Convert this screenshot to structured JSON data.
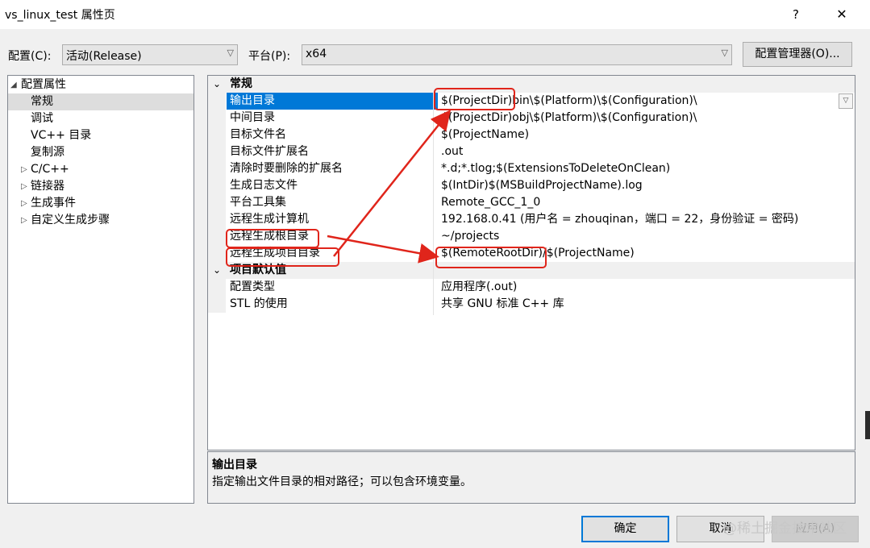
{
  "window": {
    "title": "vs_linux_test 属性页",
    "help_glyph": "?",
    "close_glyph": "✕"
  },
  "config": {
    "label": "配置(C):",
    "value": "活动(Release)",
    "platform_label": "平台(P):",
    "platform_value": "x64",
    "manager_button": "配置管理器(O)..."
  },
  "tree": {
    "root": "配置属性",
    "items": [
      {
        "label": "常规",
        "selected": true,
        "expandable": false
      },
      {
        "label": "调试",
        "selected": false,
        "expandable": false
      },
      {
        "label": "VC++ 目录",
        "selected": false,
        "expandable": false
      },
      {
        "label": "复制源",
        "selected": false,
        "expandable": false
      },
      {
        "label": "C/C++",
        "selected": false,
        "expandable": true
      },
      {
        "label": "链接器",
        "selected": false,
        "expandable": true
      },
      {
        "label": "生成事件",
        "selected": false,
        "expandable": true
      },
      {
        "label": "自定义生成步骤",
        "selected": false,
        "expandable": true
      }
    ]
  },
  "grid": {
    "categories": [
      {
        "name": "常规",
        "properties": [
          {
            "name": "输出目录",
            "value": "$(ProjectDir)bin\\$(Platform)\\$(Configuration)\\",
            "selected": true
          },
          {
            "name": "中间目录",
            "value": "$(ProjectDir)obj\\$(Platform)\\$(Configuration)\\"
          },
          {
            "name": "目标文件名",
            "value": "$(ProjectName)"
          },
          {
            "name": "目标文件扩展名",
            "value": ".out"
          },
          {
            "name": "清除时要删除的扩展名",
            "value": "*.d;*.tlog;$(ExtensionsToDeleteOnClean)"
          },
          {
            "name": "生成日志文件",
            "value": "$(IntDir)$(MSBuildProjectName).log"
          },
          {
            "name": "平台工具集",
            "value": "Remote_GCC_1_0"
          },
          {
            "name": "远程生成计算机",
            "value": "192.168.0.41 (用户名 = zhouqinan，端口 = 22，身份验证 = 密码)"
          },
          {
            "name": "远程生成根目录",
            "value": "~/projects"
          },
          {
            "name": "远程生成项目目录",
            "value": "$(RemoteRootDir)/$(ProjectName)"
          }
        ]
      },
      {
        "name": "项目默认值",
        "properties": [
          {
            "name": "配置类型",
            "value": "应用程序(.out)"
          },
          {
            "name": "STL 的使用",
            "value": "共享 GNU 标准 C++ 库"
          }
        ]
      }
    ]
  },
  "description": {
    "title": "输出目录",
    "text": "指定输出文件目录的相对路径；可以包含环境变量。"
  },
  "buttons": {
    "ok": "确定",
    "cancel": "取消",
    "apply": "应用(A)"
  },
  "watermark": "@稀土掘金技术社区",
  "annotation_color": "#e0251b",
  "accent_color": "#0078d7"
}
